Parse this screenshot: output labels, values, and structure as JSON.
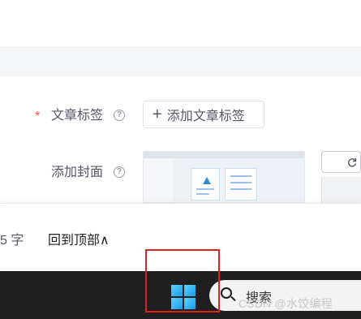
{
  "form": {
    "tags_label": "文章标签",
    "required_mark": "*",
    "add_tag_button": "添加文章标签",
    "add_tag_plus": "+",
    "cover_label": "添加封面",
    "help_mark": "?"
  },
  "footer": {
    "word_count": "5 字",
    "back_to_top": "回到顶部∧"
  },
  "taskbar": {
    "search_text": "搜索",
    "start_icon": "windows-logo"
  },
  "watermark": {
    "text": "CSDN @水饺编程"
  },
  "colors": {
    "required": "#fc5531",
    "taskbar": "#1f1f1f",
    "highlight": "#e02020"
  }
}
